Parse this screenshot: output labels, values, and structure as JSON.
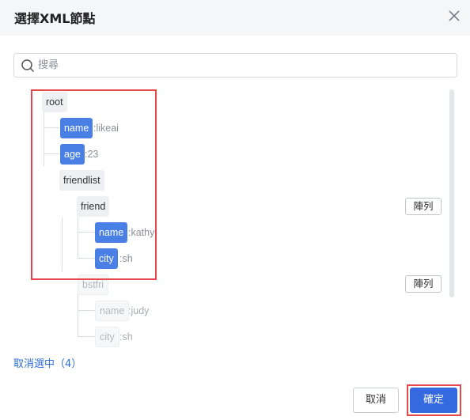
{
  "dialog": {
    "title": "選擇XML節點",
    "close_icon": "close-icon"
  },
  "search": {
    "placeholder": "搜尋",
    "value": ""
  },
  "tree": {
    "root": {
      "label": "root"
    },
    "name": {
      "label": "name",
      "value": ":likeai"
    },
    "age": {
      "label": "age",
      "value": ":23"
    },
    "friendlist": {
      "label": "friendlist"
    },
    "friend": {
      "label": "friend"
    },
    "friend_name": {
      "label": "name",
      "value": ":kathy"
    },
    "friend_city": {
      "label": "city",
      "value": ":sh"
    },
    "bstfri": {
      "label": "bstfri"
    },
    "bstfri_name": {
      "label": "name",
      "value": ":judy"
    },
    "bstfri_city": {
      "label": "city",
      "value": ":sh"
    }
  },
  "array_buttons": {
    "friend": "陣列",
    "bstfri": "陣列"
  },
  "footer": {
    "deselect": "取消選中（4）",
    "cancel": "取消",
    "confirm": "確定"
  },
  "colors": {
    "selected": "#4a80e6",
    "primary": "#3569e0",
    "highlight": "#e5484d",
    "link": "#2f6fd0"
  }
}
